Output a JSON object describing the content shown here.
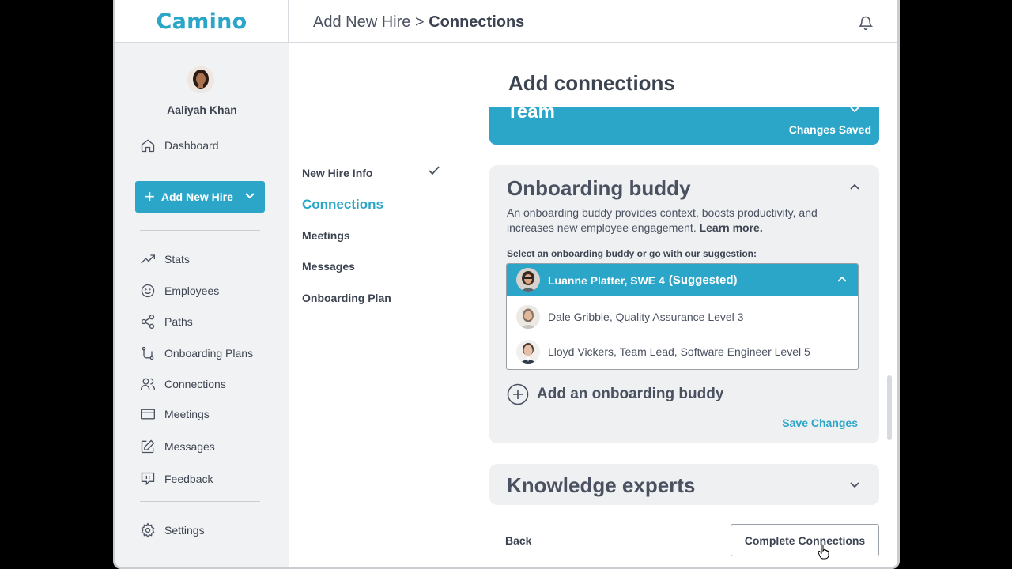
{
  "header": {
    "logo": "Camino",
    "breadcrumb_parent": "Add New Hire",
    "breadcrumb_sep": " > ",
    "breadcrumb_current": "Connections"
  },
  "sidebar": {
    "user_name": "Aaliyah Khan",
    "dashboard": "Dashboard",
    "add_new_hire": "Add New Hire",
    "items": [
      {
        "label": "Stats",
        "icon": "trending-up-icon"
      },
      {
        "label": "Employees",
        "icon": "smile-icon"
      },
      {
        "label": "Paths",
        "icon": "share-icon"
      },
      {
        "label": "Onboarding Plans",
        "icon": "route-icon"
      },
      {
        "label": "Connections",
        "icon": "users-icon"
      },
      {
        "label": "Meetings",
        "icon": "card-icon"
      },
      {
        "label": "Messages",
        "icon": "edit-icon"
      },
      {
        "label": "Feedback",
        "icon": "feedback-icon"
      }
    ],
    "settings": "Settings"
  },
  "steps": {
    "items": [
      "New Hire Info",
      "Connections",
      "Meetings",
      "Messages",
      "Onboarding Plan"
    ],
    "active": "Connections",
    "completed": [
      "New Hire Info"
    ]
  },
  "main": {
    "title": "Add connections",
    "team_card": {
      "title": "Team",
      "status": "Changes Saved"
    },
    "buddy_card": {
      "title": "Onboarding buddy",
      "description": "An onboarding buddy provides context, boosts productivity, and increases new employee engagement.",
      "learn_more": "Learn more.",
      "select_label": "Select an onboarding buddy or go with our suggestion:",
      "selected_name": "Luanne Platter, SWE 4",
      "selected_tag": "(Suggested)",
      "options": [
        "Dale Gribble, Quality Assurance Level 3",
        "Lloyd Vickers, Team Lead, Software Engineer Level 5"
      ],
      "add_label": "Add an onboarding buddy",
      "save_label": "Save Changes"
    },
    "experts_card": {
      "title": "Knowledge experts"
    },
    "back_label": "Back",
    "complete_label": "Complete Connections"
  },
  "colors": {
    "accent": "#2ba6c8",
    "card_bg": "#eef0f2",
    "text": "#3d4451"
  }
}
